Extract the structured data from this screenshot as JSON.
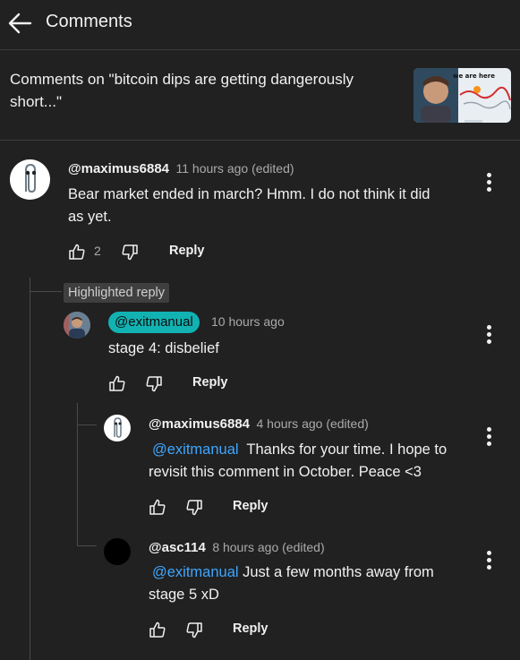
{
  "header": {
    "title": "Comments"
  },
  "context": {
    "title_line1": "Comments on \"bitcoin dips are getting dangerously",
    "title_line2": "short...\"",
    "thumbnail_caption": "we are here"
  },
  "comments": [
    {
      "handle": "@maximus6884",
      "meta": "11 hours ago (edited)",
      "text_line1": "Bear market ended in march? Hmm. I do not think it did",
      "text_line2": "as yet.",
      "likes": "2",
      "reply_label": "Reply"
    }
  ],
  "highlight_label": "Highlighted reply",
  "replies": [
    {
      "handle": "@exitmanual",
      "meta": "10 hours ago",
      "text": "stage 4: disbelief",
      "reply_label": "Reply"
    },
    {
      "handle": "@maximus6884",
      "meta": "4 hours ago (edited)",
      "mention": "@exitmanual",
      "text_line1": "  Thanks for your time. I hope to",
      "text_line2": "revisit this comment in October. Peace <3",
      "reply_label": "Reply"
    },
    {
      "handle": "@asc114",
      "meta": "8 hours ago (edited)",
      "mention": "@exitmanual",
      "text_line1": " Just a few months away from",
      "text_line2": "stage 5 xD",
      "reply_label": "Reply"
    }
  ],
  "colors": {
    "background": "#212121",
    "mention": "#3ea6ff",
    "author_chip": "#12b2b2"
  }
}
